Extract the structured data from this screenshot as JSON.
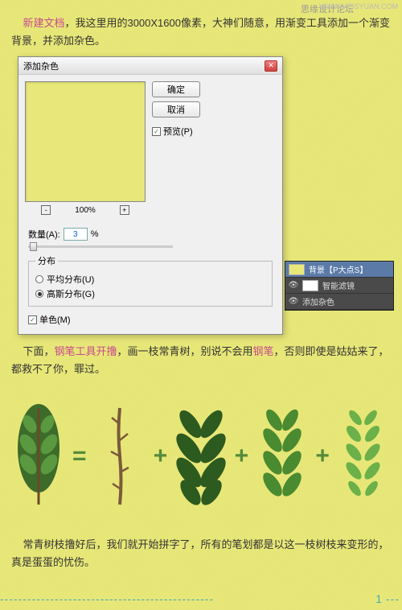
{
  "header": {
    "site": "思缘设计论坛",
    "url": "WWW.MISSYUAN.COM"
  },
  "para1": {
    "lead": "新建文档",
    "rest": "，我这里用的3000X1600像素，大神们随意，用渐变工具添加一个渐变背景，并添加杂色。"
  },
  "dialog": {
    "title": "添加杂色",
    "ok": "确定",
    "cancel": "取消",
    "preview_label": "预览(P)",
    "zoom": "100%",
    "amount_label": "数量(A):",
    "amount_value": "3",
    "amount_unit": "%",
    "dist_label": "分布",
    "dist_uniform": "平均分布(U)",
    "dist_gaussian": "高斯分布(G)",
    "mono_label": "单色(M)"
  },
  "layers": {
    "row1": "背景【P大点S】",
    "row2": "智能滤镜",
    "row3": "添加杂色"
  },
  "para2": {
    "pre": "下面，",
    "h1": "钢笔工具开撸",
    "mid": "，画一枝常青树，别说不会用",
    "h2": "钢笔",
    "rest": "，否则即使是姑姑来了，都救不了你，罪过。"
  },
  "ops": {
    "eq": "=",
    "plus": "+"
  },
  "para3": "常青树枝撸好后，我们就开始拼字了，所有的笔划都是以这一枝树枝来变形的，真是蛋蛋的忧伤。",
  "page": "1"
}
